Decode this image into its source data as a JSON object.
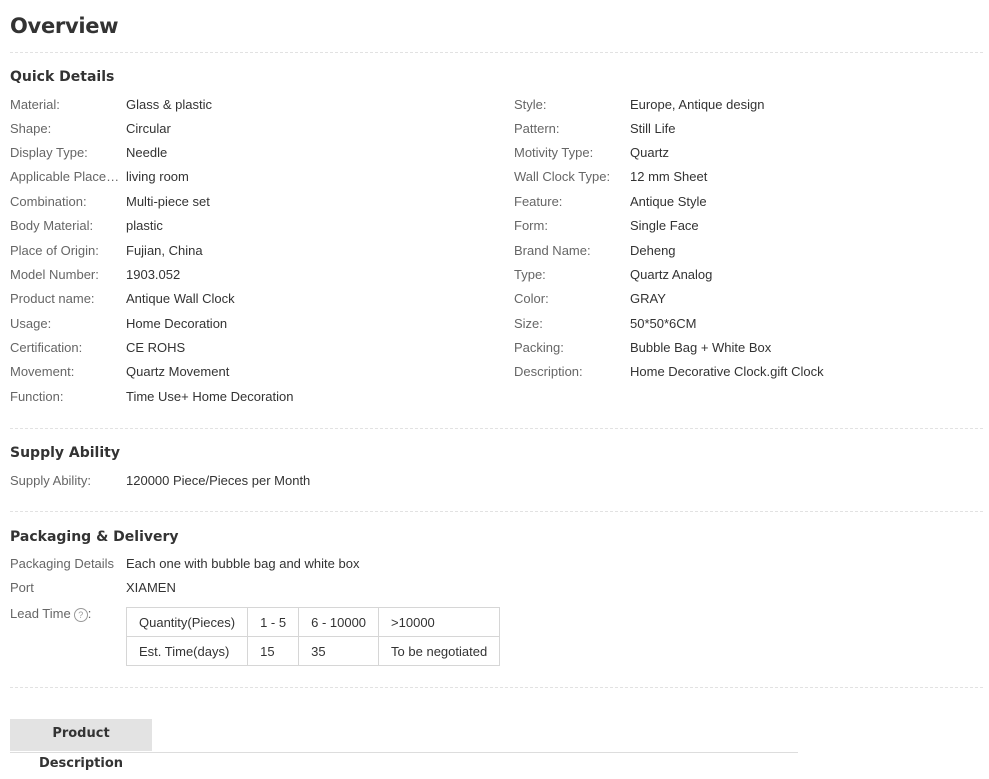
{
  "page_title": "Overview",
  "quick_details": {
    "title": "Quick Details",
    "left": [
      {
        "label": "Material:",
        "value": "Glass & plastic"
      },
      {
        "label": "Shape:",
        "value": "Circular"
      },
      {
        "label": "Display Type:",
        "value": "Needle"
      },
      {
        "label": "Applicable Placem...",
        "value": "living room"
      },
      {
        "label": "Combination:",
        "value": "Multi-piece set"
      },
      {
        "label": "Body Material:",
        "value": "plastic"
      },
      {
        "label": "Place of Origin:",
        "value": "Fujian, China"
      },
      {
        "label": "Model Number:",
        "value": "1903.052"
      },
      {
        "label": "Product name:",
        "value": "Antique Wall Clock"
      },
      {
        "label": "Usage:",
        "value": "Home Decoration"
      },
      {
        "label": "Certification:",
        "value": "CE ROHS"
      },
      {
        "label": "Movement:",
        "value": "Quartz Movement"
      },
      {
        "label": "Function:",
        "value": "Time Use+ Home Decoration"
      }
    ],
    "right": [
      {
        "label": "Style:",
        "value": "Europe, Antique design"
      },
      {
        "label": "Pattern:",
        "value": "Still Life"
      },
      {
        "label": "Motivity Type:",
        "value": "Quartz"
      },
      {
        "label": "Wall Clock Type:",
        "value": "12 mm Sheet"
      },
      {
        "label": "Feature:",
        "value": "Antique Style"
      },
      {
        "label": "Form:",
        "value": "Single Face"
      },
      {
        "label": "Brand Name:",
        "value": "Deheng"
      },
      {
        "label": "Type:",
        "value": "Quartz Analog"
      },
      {
        "label": "Color:",
        "value": "GRAY"
      },
      {
        "label": "Size:",
        "value": "50*50*6CM"
      },
      {
        "label": "Packing:",
        "value": "Bubble Bag + White Box"
      },
      {
        "label": "Description:",
        "value": "Home Decorative Clock.gift Clock"
      }
    ]
  },
  "supply": {
    "title": "Supply Ability",
    "label": "Supply Ability:",
    "value": "120000 Piece/Pieces per Month"
  },
  "packaging": {
    "title": "Packaging & Delivery",
    "details_label": "Packaging Details",
    "details_value": "Each one with bubble bag and white box",
    "port_label": "Port",
    "port_value": "XIAMEN",
    "lead_label": "Lead Time",
    "help_glyph": "?",
    "lead_table": {
      "quantity_header": "Quantity(Pieces)",
      "time_header": "Est. Time(days)",
      "quantities": [
        "1 - 5",
        "6 - 10000",
        ">10000"
      ],
      "times": [
        "15",
        "35",
        "To be negotiated"
      ]
    }
  },
  "tabs": {
    "product_description": "Product Description"
  }
}
